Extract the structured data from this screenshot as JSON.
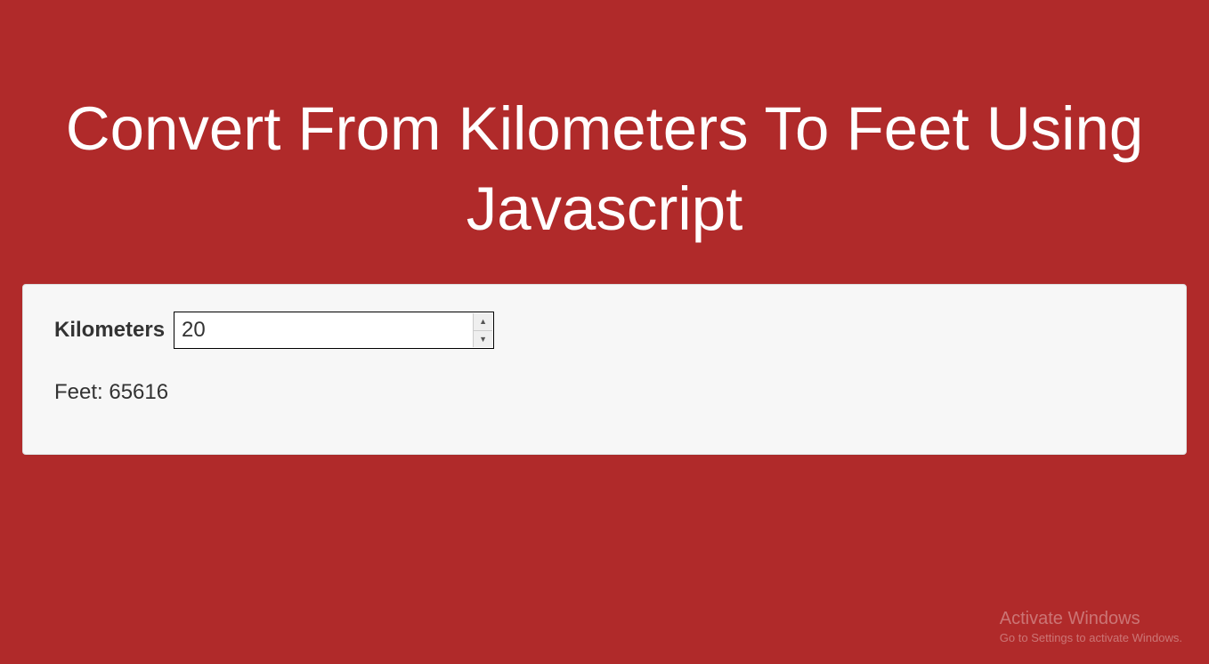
{
  "header": {
    "title": "Convert From Kilometers To Feet Using Javascript"
  },
  "form": {
    "kilometers_label": "Kilometers",
    "kilometers_value": "20",
    "kilometers_placeholder": ""
  },
  "result": {
    "feet_label": "Feet: ",
    "feet_value": "65616"
  },
  "watermark": {
    "title": "Activate Windows",
    "subtitle": "Go to Settings to activate Windows."
  }
}
